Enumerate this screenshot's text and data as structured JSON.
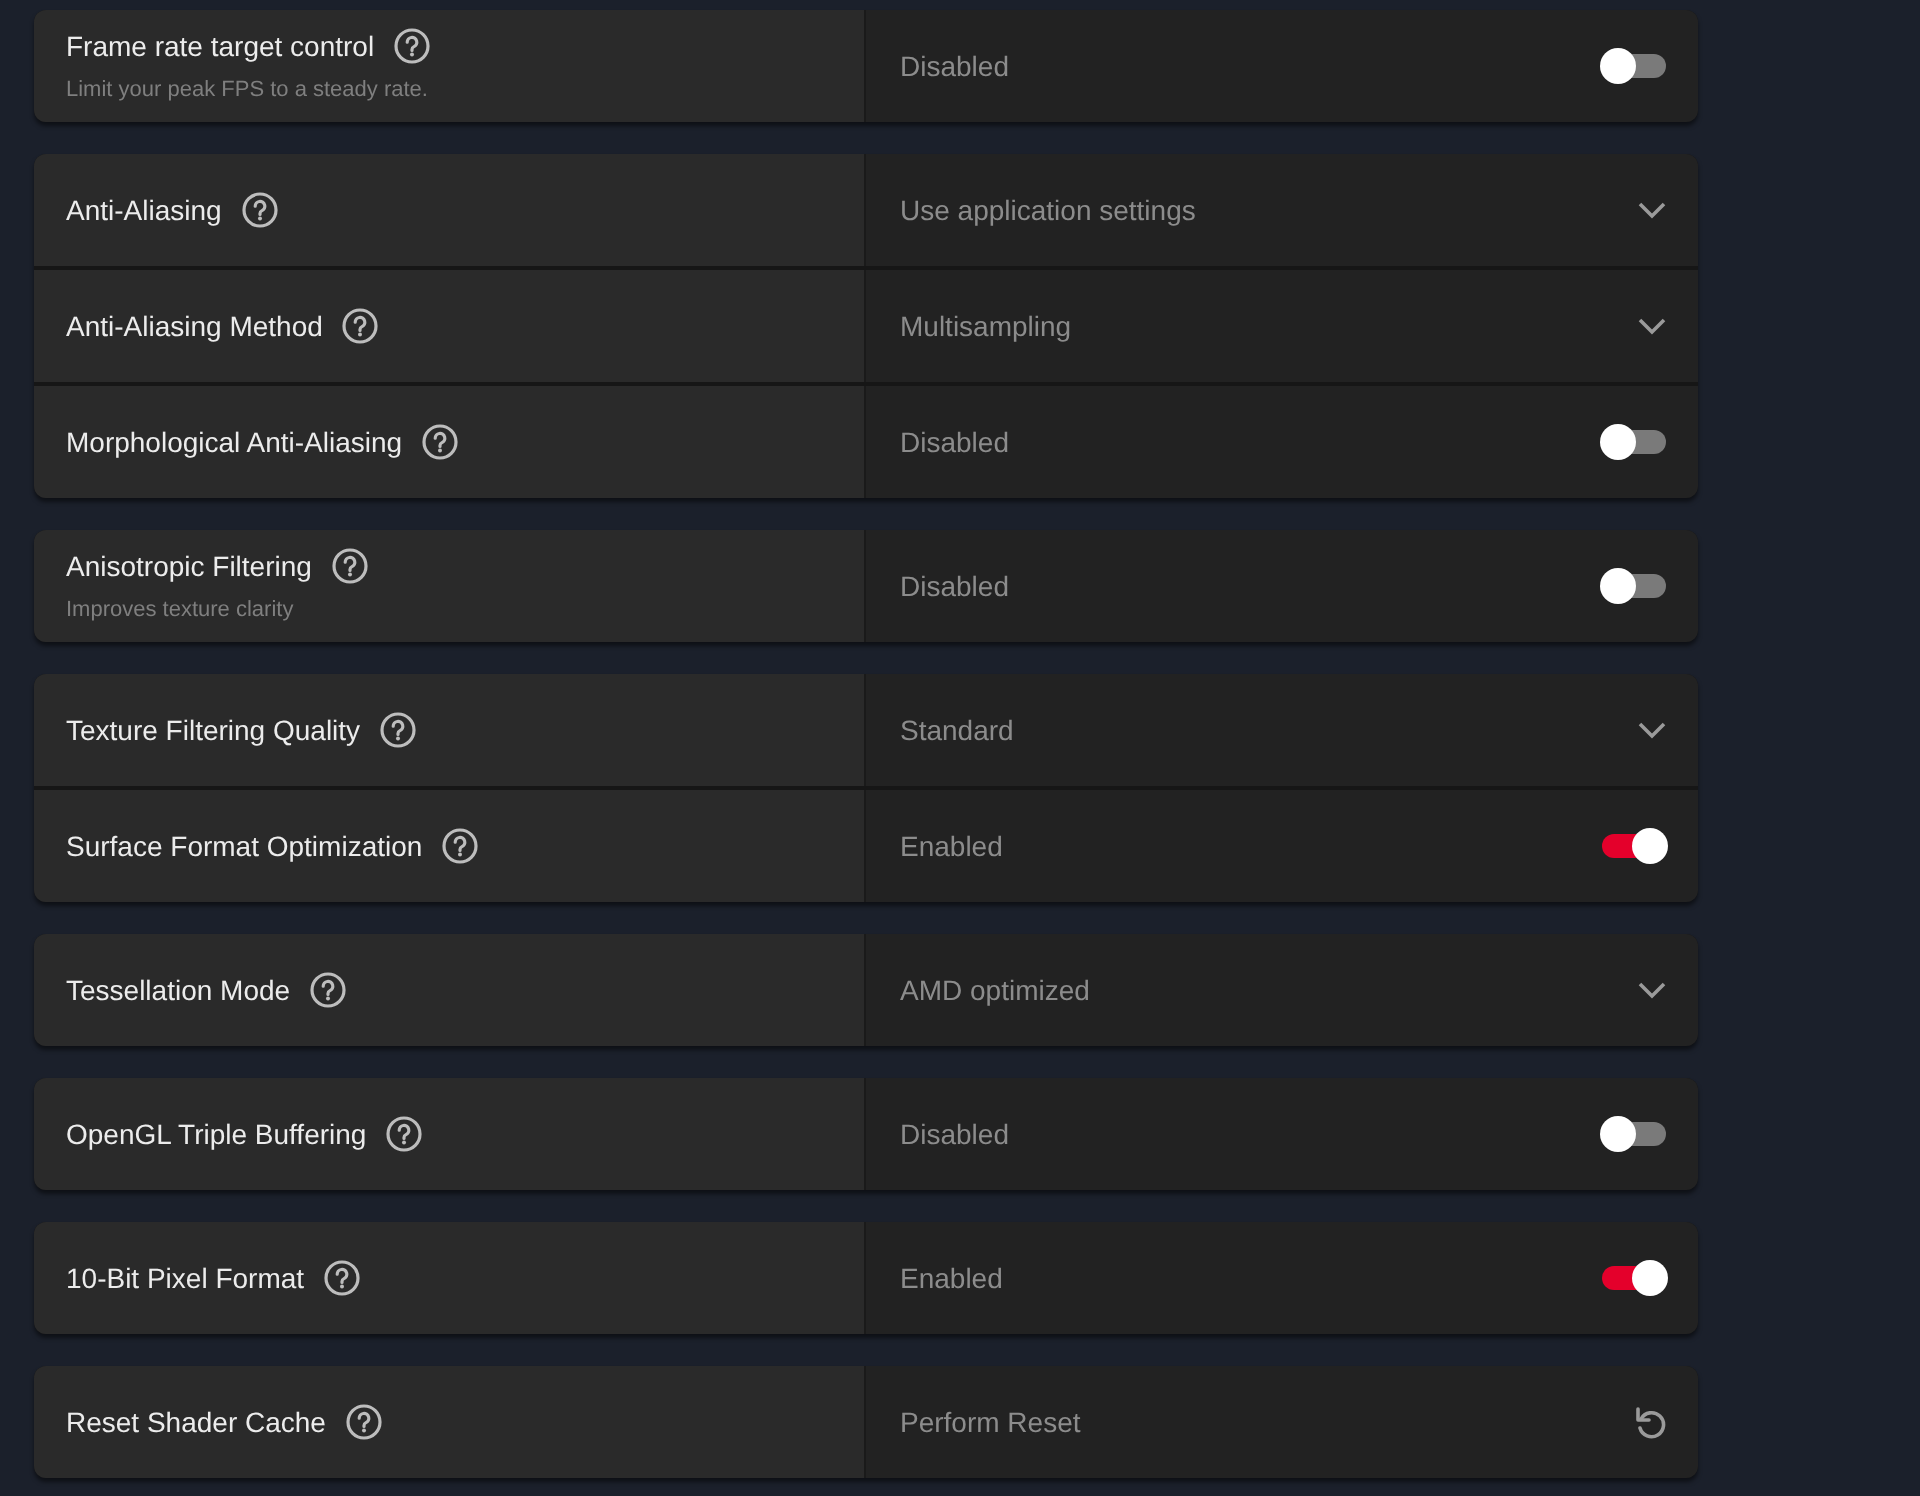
{
  "groups": [
    {
      "settings": [
        {
          "label": "Frame rate target control",
          "description": "Limit your peak FPS to a steady rate.",
          "kind": "toggle",
          "value": "Disabled",
          "on": false
        }
      ]
    },
    {
      "settings": [
        {
          "label": "Anti-Aliasing",
          "kind": "dropdown",
          "value": "Use application settings"
        },
        {
          "label": "Anti-Aliasing Method",
          "kind": "dropdown",
          "value": "Multisampling"
        },
        {
          "label": "Morphological Anti-Aliasing",
          "kind": "toggle",
          "value": "Disabled",
          "on": false
        }
      ]
    },
    {
      "settings": [
        {
          "label": "Anisotropic Filtering",
          "description": "Improves texture clarity",
          "kind": "toggle",
          "value": "Disabled",
          "on": false
        }
      ]
    },
    {
      "settings": [
        {
          "label": "Texture Filtering Quality",
          "kind": "dropdown",
          "value": "Standard"
        },
        {
          "label": "Surface Format Optimization",
          "kind": "toggle",
          "value": "Enabled",
          "on": true
        }
      ]
    },
    {
      "settings": [
        {
          "label": "Tessellation Mode",
          "kind": "dropdown",
          "value": "AMD optimized"
        }
      ]
    },
    {
      "settings": [
        {
          "label": "OpenGL Triple Buffering",
          "kind": "toggle",
          "value": "Disabled",
          "on": false
        }
      ]
    },
    {
      "settings": [
        {
          "label": "10-Bit Pixel Format",
          "kind": "toggle",
          "value": "Enabled",
          "on": true
        }
      ]
    },
    {
      "settings": [
        {
          "label": "Reset Shader Cache",
          "kind": "action",
          "value": "Perform Reset"
        }
      ]
    }
  ]
}
